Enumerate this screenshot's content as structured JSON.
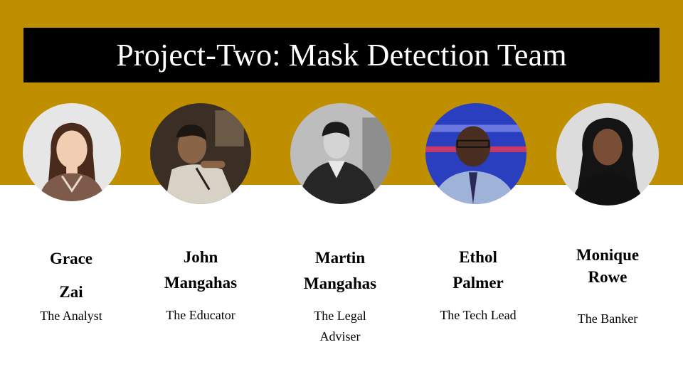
{
  "slide": {
    "title": "Project-Two: Mask Detection Team",
    "colors": {
      "band": "#bf8f00",
      "title_bg": "#000000",
      "title_text": "#ffffff"
    }
  },
  "members": [
    {
      "name_line1": "Grace",
      "name_line2": "Zai",
      "role_line1": "The Analyst",
      "role_line2": ""
    },
    {
      "name_line1": "John",
      "name_line2": "Mangahas",
      "role_line1": "The Educator",
      "role_line2": ""
    },
    {
      "name_line1": "Martin",
      "name_line2": "Mangahas",
      "role_line1": "The Legal",
      "role_line2": "Adviser"
    },
    {
      "name_line1": "Ethol",
      "name_line2": "Palmer",
      "role_line1": "The Tech Lead",
      "role_line2": ""
    },
    {
      "name_line1": "Monique",
      "name_line2": "Rowe",
      "role_line1": "The Banker",
      "role_line2": ""
    }
  ]
}
